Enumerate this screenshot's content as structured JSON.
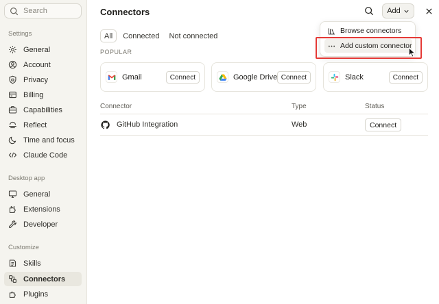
{
  "sidebar": {
    "search_placeholder": "Search",
    "sections": [
      {
        "label": "Settings",
        "items": [
          {
            "label": "General",
            "icon": "gear-icon"
          },
          {
            "label": "Account",
            "icon": "account-icon"
          },
          {
            "label": "Privacy",
            "icon": "shield-icon"
          },
          {
            "label": "Billing",
            "icon": "billing-icon"
          },
          {
            "label": "Capabilities",
            "icon": "briefcase-icon"
          },
          {
            "label": "Reflect",
            "icon": "reflect-icon"
          },
          {
            "label": "Time and focus",
            "icon": "moon-icon"
          },
          {
            "label": "Claude Code",
            "icon": "code-icon"
          }
        ]
      },
      {
        "label": "Desktop app",
        "items": [
          {
            "label": "General",
            "icon": "monitor-icon"
          },
          {
            "label": "Extensions",
            "icon": "puzzle-icon"
          },
          {
            "label": "Developer",
            "icon": "wrench-icon"
          }
        ]
      },
      {
        "label": "Customize",
        "items": [
          {
            "label": "Skills",
            "icon": "skills-icon"
          },
          {
            "label": "Connectors",
            "icon": "connectors-icon",
            "active": true
          },
          {
            "label": "Plugins",
            "icon": "plugin-icon"
          }
        ]
      }
    ]
  },
  "header": {
    "title": "Connectors",
    "add_label": "Add"
  },
  "filters": [
    {
      "label": "All",
      "active": true
    },
    {
      "label": "Connected"
    },
    {
      "label": "Not connected"
    }
  ],
  "popular_label": "POPULAR",
  "popular_cards": [
    {
      "name": "Gmail",
      "button": "Connect",
      "icon": "gmail-icon"
    },
    {
      "name": "Google Drive",
      "button": "Connect",
      "icon": "google-drive-icon"
    },
    {
      "name": "Slack",
      "button": "Connect",
      "icon": "slack-icon"
    }
  ],
  "table": {
    "headers": [
      "Connector",
      "Type",
      "Status"
    ],
    "rows": [
      {
        "name": "GitHub Integration",
        "type": "Web",
        "status_button": "Connect",
        "icon": "github-icon"
      }
    ]
  },
  "dropdown": {
    "items": [
      {
        "label": "Browse connectors",
        "icon": "library-icon"
      },
      {
        "label": "Add custom connector",
        "icon": "ellipsis-icon",
        "hovered": true
      }
    ]
  },
  "colors": {
    "highlight": "#e53935",
    "sidebar_bg": "#f5f4ef",
    "active_item_bg": "#e9e7df"
  }
}
